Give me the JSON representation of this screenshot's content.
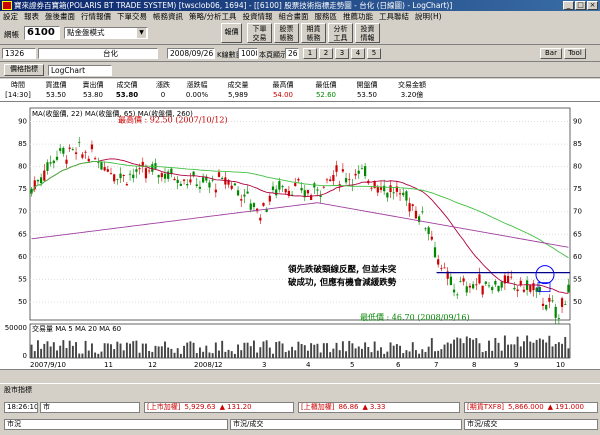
{
  "window": {
    "title": "寶來證券百寶箱(POLARIS BT TRADE SYSTEM)  [twsclob06, 1694] - [[6100] 股票技術指標走勢圖 - 台化 (日線圖) - LogChart)]"
  },
  "menu": [
    "設定",
    "報表",
    "盤後畫面",
    "行情報價",
    "下單交易",
    "帳務資訊",
    "策略/分析工具",
    "投資情報",
    "組合畫面",
    "服務區",
    "推薦功能",
    "工具聯結",
    "說明(H)"
  ],
  "toolbar": {
    "account_label": "網帳",
    "code": "6100",
    "dropdown": "點金盤模式",
    "report_btn": "報價",
    "buttons": [
      "下單\n交易",
      "股票\n帳務",
      "期貨\n帳務",
      "分析\n工具",
      "投資\n情報"
    ]
  },
  "row2": {
    "stock": "1326",
    "stock_name": "台化",
    "date": "2008/09/26",
    "kline_label": "K線數目",
    "kline_count": "1000",
    "display_label": "本頁顯示",
    "display_count": "260",
    "pages": [
      "1",
      "2",
      "3",
      "4",
      "5"
    ],
    "tools": [
      "Bar",
      "Tool"
    ]
  },
  "row3": {
    "indicator_btn": "價格指標",
    "chart_type": "LogChart"
  },
  "info": {
    "headers": [
      "時間",
      "買進價",
      "賣出價",
      "成交價",
      "漲跌",
      "漲跌幅",
      "成交量",
      "最高價",
      "最低價",
      "開盤價",
      "交易金額"
    ],
    "values": [
      "[14:30]",
      "53.50",
      "53.80",
      "53.80",
      "0",
      "0.00%",
      "5,989",
      "54.00",
      "52.60",
      "53.50",
      "3.20億"
    ],
    "value_colors": [
      "#000",
      "#000",
      "#000",
      "#000",
      "#000",
      "#000",
      "#000",
      "#c00",
      "#080",
      "#000",
      "#000"
    ]
  },
  "chart": {
    "ma_legend": "MA(收盤價, 22)  MA(收盤價, 65)  MA(收盤價, 260)",
    "high_label": "最高價 : 92.50 (2007/10/12)",
    "low_label": "最低價 : 46.70 (2008/09/16)",
    "annotation_lines": [
      "領先跌破頸線反壓, 但並未突",
      "破成功, 但應有機會減緩跌勢"
    ],
    "vol_legend": "交易量  MA 5  MA 20  MA 60",
    "vol_axis_max": "50000",
    "vol_axis_zero": "0",
    "y_ticks": [
      "90",
      "85",
      "80",
      "75",
      "70",
      "65",
      "60",
      "55",
      "50"
    ],
    "x_labels": [
      "2007/9/10",
      "11",
      "12",
      "2008/1",
      "2",
      "3",
      "4",
      "5",
      "6",
      "7",
      "8",
      "9",
      "10"
    ],
    "neckline_price": 56.5
  },
  "tab": {
    "label": "股市指標"
  },
  "status": {
    "time": "18:26:10",
    "market_label": "市",
    "items": [
      {
        "label": "[上市加權]",
        "value": "5,929.63",
        "change": "131.20"
      },
      {
        "label": "[上櫃加權]",
        "value": "86.86",
        "change": "3.33"
      },
      {
        "label": "[期貨TXF8]",
        "value": "5,866.000",
        "change": "191.000"
      }
    ],
    "bottom": [
      "市況",
      "市況/成交",
      "市況/成交"
    ]
  },
  "colors": {
    "up": "#c00",
    "down": "#080",
    "ma22": "#b00040",
    "ma65": "#40c040",
    "ma260": "#a040a0",
    "neckline": "#00008b"
  }
}
